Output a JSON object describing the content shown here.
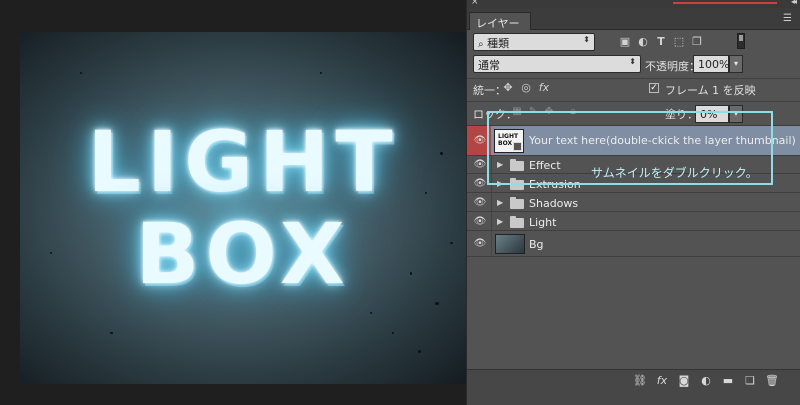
{
  "canvas": {
    "line1": "LIGHT",
    "line2": "BOX"
  },
  "panel": {
    "tab_title": "レイヤー",
    "filter_select": "種類",
    "blend_mode": "通常",
    "opacity_label": "不透明度：",
    "opacity_value": "100%",
    "unify_label": "統一：",
    "frame_label": "フレーム 1 を反映",
    "lock_label": "ロック：",
    "fill_label": "塗り：",
    "fill_value": "0%"
  },
  "layers": [
    {
      "name": "Your text here(double-ckick the layer thumbnail)",
      "type": "smart-object",
      "selected": true,
      "thumb_text": "LIGHT BOX"
    },
    {
      "name": "Effect",
      "type": "group"
    },
    {
      "name": "Extrusion",
      "type": "group"
    },
    {
      "name": "Shadows",
      "type": "group"
    },
    {
      "name": "Light",
      "type": "group"
    },
    {
      "name": "Bg",
      "type": "pixel"
    }
  ],
  "annotation": "サムネイルをダブルクリック。",
  "colors": {
    "selected_row": "#7f8ea2",
    "highlight": "#8fdde6",
    "eye_selected": "#b44545"
  }
}
